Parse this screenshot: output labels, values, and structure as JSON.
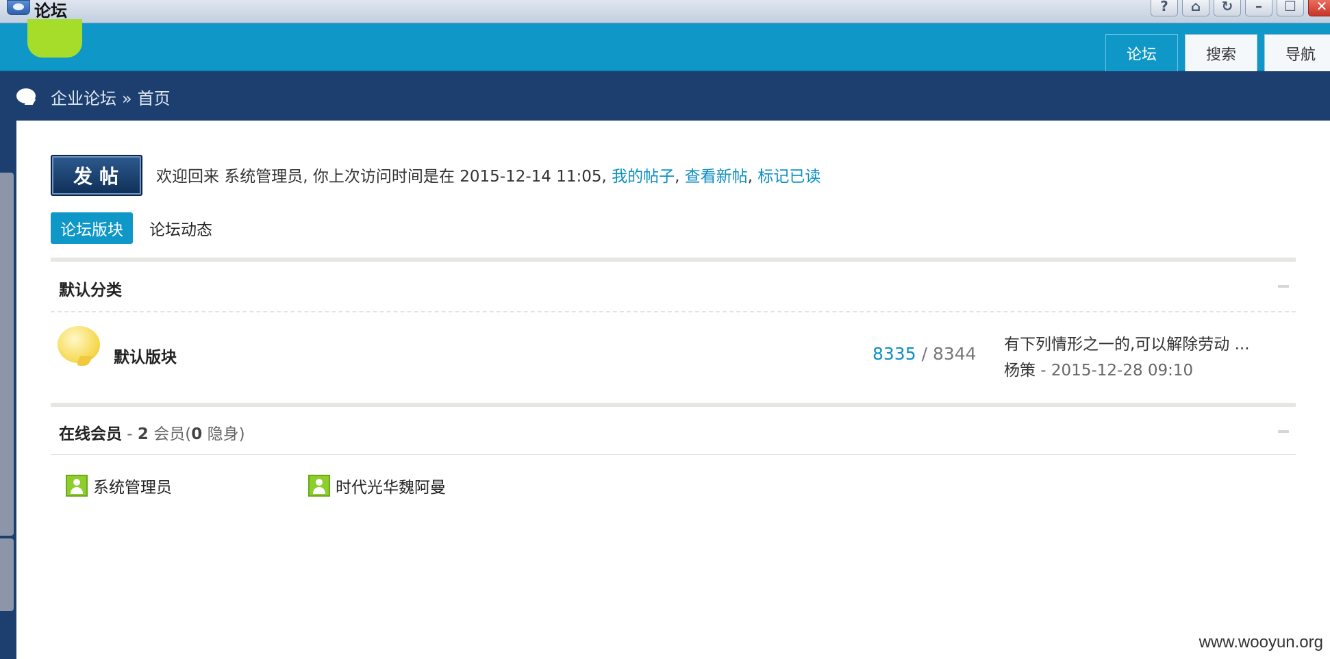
{
  "window": {
    "title": "论坛",
    "controls": [
      "help-icon",
      "home-icon",
      "refresh-icon",
      "minimize-icon",
      "maximize-icon",
      "close-icon"
    ],
    "control_glyphs": [
      "?",
      "⌂",
      "↻",
      "–",
      "☐",
      "✕"
    ]
  },
  "nav": {
    "tabs": [
      {
        "label": "论坛",
        "active": true
      },
      {
        "label": "搜索",
        "active": false
      },
      {
        "label": "导航",
        "active": false
      }
    ]
  },
  "breadcrumb": {
    "items": [
      "企业论坛",
      "首页"
    ],
    "separator": "»"
  },
  "toolbar": {
    "post_label": "发帖"
  },
  "welcome": {
    "prefix": "欢迎回来 系统管理员, 你上次访问时间是在 2015-12-14 11:05, ",
    "my_posts": "我的帖子",
    "view_new": "查看新帖",
    "mark_read": "标记已读"
  },
  "subtabs": [
    {
      "label": "论坛版块",
      "active": true
    },
    {
      "label": "论坛动态",
      "active": false
    }
  ],
  "category": {
    "title": "默认分类",
    "forums": [
      {
        "name": "默认版块",
        "topics": "8335",
        "posts": "8344",
        "last_post_title": "有下列情形之一的,可以解除劳动 ...",
        "last_post_author": "杨策",
        "last_post_time": "2015-12-28 09:10"
      }
    ]
  },
  "online": {
    "title": "在线会员",
    "count": "2",
    "members_label": "会员(",
    "hidden": "0",
    "hidden_label": "隐身)",
    "users": [
      "系统管理员",
      "时代光华魏阿曼"
    ]
  },
  "watermark": "www.wooyun.org",
  "colors": {
    "header": "#0f97c7",
    "crumbbar": "#1d3f6f",
    "link": "#0e8fc4",
    "logo": "#a6dd2a"
  }
}
